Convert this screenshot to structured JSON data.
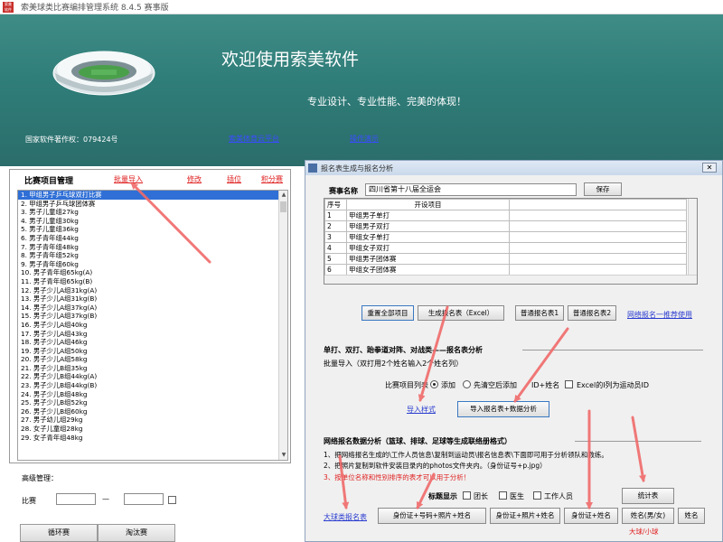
{
  "window": {
    "title": "索美球类比赛编排管理系统   8.4.5   赛事版",
    "app_icon_label": "索美 软件"
  },
  "banner": {
    "welcome": "欢迎使用索美软件",
    "slogan": "专业设计、专业性能、完美的体现！",
    "copyright": "国家软件著作权：079424号",
    "links": [
      "索美体育云平台",
      "操作演示"
    ]
  },
  "events_panel": {
    "title": "比赛项目管理",
    "links": [
      "批量导入",
      "修改",
      "插位",
      "积分赛"
    ],
    "selected_index": 0,
    "items": [
      "1.  甲组男子乒乓球双打比赛",
      "2.  甲组男子乒乓球团体赛",
      "3.  男子儿童组27kg",
      "4.  男子儿童组30kg",
      "5.  男子儿童组36kg",
      "6.  男子青年组44kg",
      "7.  男子青年组48kg",
      "8.  男子青年组52kg",
      "9.  男子青年组60kg",
      "10. 男子青年组65kg(A)",
      "11. 男子青年组65kg(B)",
      "12. 男子少儿A组31kg(A)",
      "13. 男子少儿A组31kg(B)",
      "14. 男子少儿A组37kg(A)",
      "15. 男子少儿A组37kg(B)",
      "16. 男子少儿A组40kg",
      "17. 男子少儿A组43kg",
      "18. 男子少儿A组46kg",
      "19. 男子少儿A组50kg",
      "20. 男子少儿A组58kg",
      "21. 男子少儿B组35kg",
      "22. 男子少儿B组44kg(A)",
      "23. 男子少儿B组44kg(B)",
      "24. 男子少儿B组48kg",
      "25. 男子少儿B组52kg",
      "26. 男子少儿B组60kg",
      "27. 男子幼儿组29kg",
      "28. 女子儿童组28kg",
      "29. 女子青年组48kg"
    ]
  },
  "advanced": {
    "label": "高级管理：",
    "match_label": "比赛",
    "dash": "—",
    "buttons": [
      "循环赛",
      "淘汰赛"
    ]
  },
  "dialog": {
    "title": "报名表生成与报名分析",
    "close": "✕",
    "event_name_label": "赛事名称",
    "event_name_value": "四川省第十八届全运会",
    "save_button": "保存",
    "grid": {
      "headers": [
        "序号",
        "开设项目"
      ],
      "rows": [
        [
          "1",
          "甲组男子单打"
        ],
        [
          "2",
          "甲组男子双打"
        ],
        [
          "3",
          "甲组女子单打"
        ],
        [
          "4",
          "甲组女子双打"
        ],
        [
          "5",
          "甲组男子团体赛"
        ],
        [
          "6",
          "甲组女子团体赛"
        ],
        [
          "7",
          ""
        ]
      ]
    },
    "buttons_row1": [
      "重置全部项目",
      "生成报名表（Excel）",
      "普通报名表1",
      "普通报名表2"
    ],
    "online_link": "网络报名一推荐使用",
    "section1_title": "单打、双打、跆拳道对阵、对战类——报名表分析",
    "section1_desc": "批量导入（双打用2个姓名输入2个姓名列）",
    "list_label": "比赛项目列表",
    "radio_add": "添加",
    "radio_clear": "先清空后添加",
    "id_name_label": "ID+姓名",
    "excel_option": "Excel的I列为运动员ID",
    "import_sample_link": "导入样式",
    "import_button": "导入报名表+数据分析",
    "section2_title": "网络报名数据分析（篮球、排球、足球等生成联络册格式）",
    "section2_line1": "1、把网络报名生成的\\工作人员信息\\复制到运动员\\报名信息表\\下面即可用于分析领队和教练。",
    "section2_line2": "2、把照片复制到软件安装目录内的photos文件夹内。（身份证号+p.jpg）",
    "section2_line3": "3、按单位名称和性别排序的表才可以用于分析！",
    "title_show_label": "标题显示",
    "checks": [
      "团长",
      "医生",
      "工作人员"
    ],
    "stats_button": "统计表",
    "sample_link": "大球类报名表",
    "bottom_buttons": [
      "身份证+号码+照片+姓名",
      "身份证+照片+姓名",
      "身份证+姓名",
      "姓名(男/女)",
      "姓名"
    ],
    "ball_note": "大球/小球"
  }
}
